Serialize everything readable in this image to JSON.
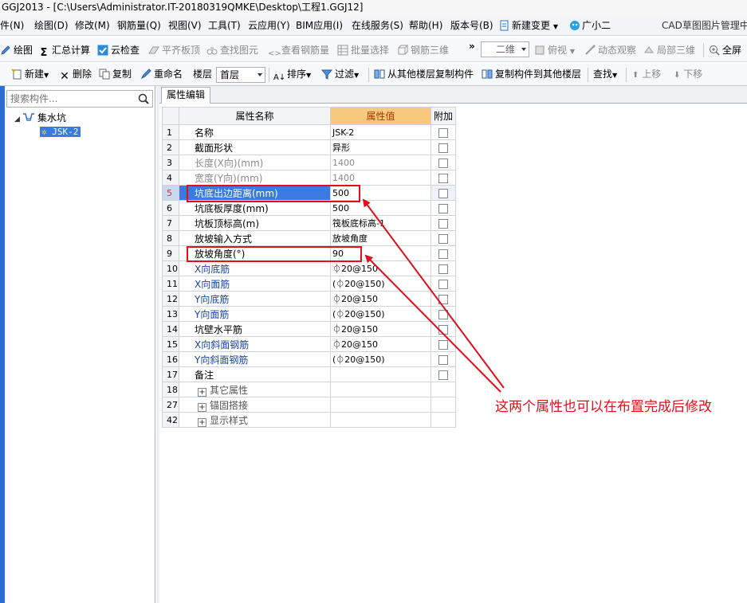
{
  "titlebar": {
    "text": "GGJ2013 - [C:\\Users\\Administrator.IT-20180319QMKE\\Desktop\\工程1.GGJ12]"
  },
  "menubar": {
    "items": [
      "件(N)",
      "绘图(D)",
      "修改(M)",
      "钢筋量(Q)",
      "视图(V)",
      "工具(T)",
      "云应用(Y)",
      "BIM应用(I)",
      "在线服务(S)",
      "帮助(H)",
      "版本号(B)"
    ],
    "new_change": "新建变更",
    "assistant": "广小二",
    "cad_manager": "CAD草图图片管理中"
  },
  "toolbar1": {
    "draw": "绘图",
    "sum_calc": "汇总计算",
    "cloud_check": "云检查",
    "flush_slab": "平齐板顶",
    "find_element": "查找图元",
    "view_rebar": "查看钢筋量",
    "batch_select": "批量选择",
    "rebar_3d": "钢筋三维",
    "view_mode": "二维",
    "top_view": "俯视",
    "dynamic_view": "动态观察",
    "local_3d": "局部三维",
    "fullscreen": "全屏"
  },
  "toolbar2": {
    "new": "新建",
    "delete": "删除",
    "copy": "复制",
    "rename": "重命名",
    "floor_label": "楼层",
    "floor_value": "首层",
    "sort": "排序",
    "filter": "过滤",
    "copy_from_other": "从其他楼层复制构件",
    "copy_to_other": "复制构件到其他楼层",
    "find": "查找",
    "move_up": "上移",
    "move_down": "下移"
  },
  "sidebar": {
    "search_placeholder": "搜索构件...",
    "tree_root": "集水坑",
    "tree_child": "JSK-2"
  },
  "tab": {
    "label": "属性编辑"
  },
  "grid": {
    "headers": {
      "name": "属性名称",
      "value": "属性值",
      "extra": "附加"
    },
    "rows": [
      {
        "num": "1",
        "name": "名称",
        "value": "JSK-2"
      },
      {
        "num": "2",
        "name": "截面形状",
        "value": "异形"
      },
      {
        "num": "3",
        "name": "长度(X向)(mm)",
        "value": "1400"
      },
      {
        "num": "4",
        "name": "宽度(Y向)(mm)",
        "value": "1400"
      },
      {
        "num": "5",
        "name": "坑底出边距离(mm)",
        "value": "500"
      },
      {
        "num": "6",
        "name": "坑底板厚度(mm)",
        "value": "500"
      },
      {
        "num": "7",
        "name": "坑板顶标高(m)",
        "value": "筏板底标高-1"
      },
      {
        "num": "8",
        "name": "放坡输入方式",
        "value": "放坡角度"
      },
      {
        "num": "9",
        "name": "放坡角度(°)",
        "value": "90"
      },
      {
        "num": "10",
        "name": "X向底筋",
        "value": "⏀20@150"
      },
      {
        "num": "11",
        "name": "X向面筋",
        "value": "(⏀20@150)"
      },
      {
        "num": "12",
        "name": "Y向底筋",
        "value": "⏀20@150"
      },
      {
        "num": "13",
        "name": "Y向面筋",
        "value": "(⏀20@150)"
      },
      {
        "num": "14",
        "name": "坑壁水平筋",
        "value": "⏀20@150"
      },
      {
        "num": "15",
        "name": "X向斜面钢筋",
        "value": "⏀20@150"
      },
      {
        "num": "16",
        "name": "Y向斜面钢筋",
        "value": "(⏀20@150)"
      },
      {
        "num": "17",
        "name": "备注",
        "value": ""
      },
      {
        "num": "18",
        "name": "其它属性",
        "value": ""
      },
      {
        "num": "27",
        "name": "锚固搭接",
        "value": ""
      },
      {
        "num": "42",
        "name": "显示样式",
        "value": ""
      }
    ]
  },
  "annotation": {
    "text": "这两个属性也可以在布置完成后修改"
  },
  "colors": {
    "annotation_red": "#e0101a",
    "selection_blue": "#3a7be0",
    "value_header_orange": "#f7c97c"
  }
}
